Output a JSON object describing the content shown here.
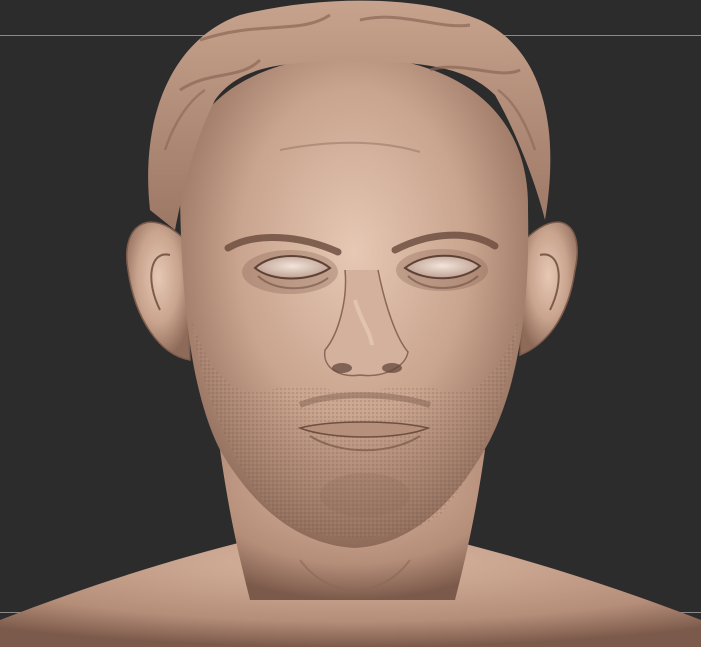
{
  "viewport": {
    "background": "#2c2c2c",
    "guide_color": "#8a8a8a",
    "subject": "clay-head-sculpt"
  },
  "colors": {
    "clay_base": "#c9a48e",
    "clay_light": "#e3c5b1",
    "clay_shadow": "#8a6757",
    "clay_deep": "#5e4236"
  }
}
